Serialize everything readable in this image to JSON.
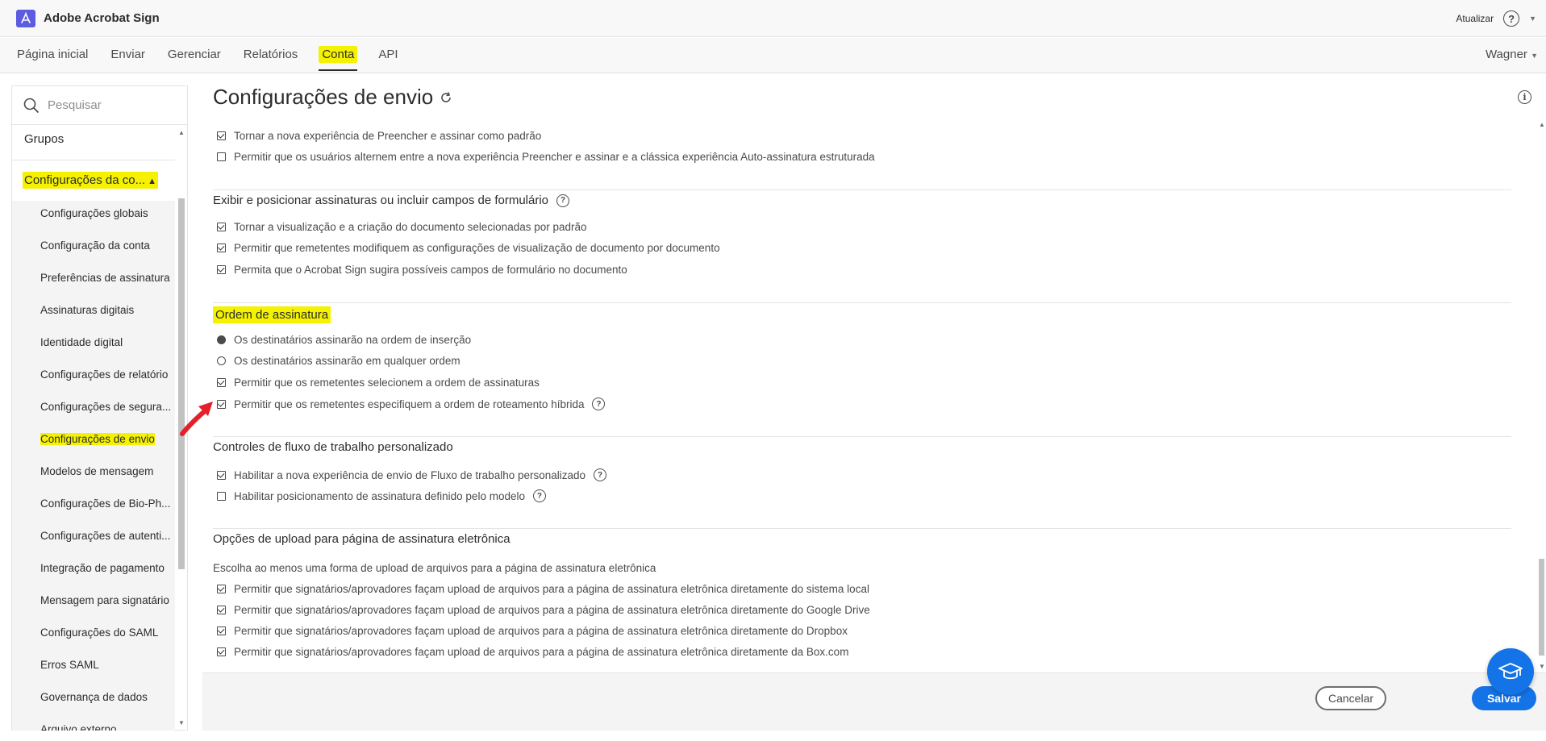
{
  "app": {
    "title": "Adobe Acrobat Sign"
  },
  "topbar": {
    "update_label": "Atualizar",
    "help_symbol": "?"
  },
  "nav": {
    "items": [
      {
        "label": "Página inicial"
      },
      {
        "label": "Enviar"
      },
      {
        "label": "Gerenciar"
      },
      {
        "label": "Relatórios"
      },
      {
        "label": "Conta"
      },
      {
        "label": "API"
      }
    ],
    "active": "Conta",
    "user": "Wagner"
  },
  "sidebar": {
    "search_placeholder": "Pesquisar",
    "group": "Grupos",
    "parent": "Configurações da co...",
    "children": [
      {
        "label": "Configurações globais"
      },
      {
        "label": "Configuração da conta"
      },
      {
        "label": "Preferências de assinatura"
      },
      {
        "label": "Assinaturas digitais"
      },
      {
        "label": "Identidade digital"
      },
      {
        "label": "Configurações de relatório"
      },
      {
        "label": "Configurações de segura..."
      },
      {
        "label": "Configurações de envio"
      },
      {
        "label": "Modelos de mensagem"
      },
      {
        "label": "Configurações de Bio-Ph..."
      },
      {
        "label": "Configurações de autenti..."
      },
      {
        "label": "Integração de pagamento"
      },
      {
        "label": "Mensagem para signatário"
      },
      {
        "label": "Configurações do SAML"
      },
      {
        "label": "Erros SAML"
      },
      {
        "label": "Governança de dados"
      },
      {
        "label": "Arquivo externo"
      }
    ],
    "active_child": "Configurações de envio"
  },
  "main": {
    "title": "Configurações de envio",
    "top_options": [
      {
        "label": "Tornar a nova experiência de Preencher e assinar como padrão",
        "checked": true
      },
      {
        "label": "Permitir que os usuários alternem entre a nova experiência Preencher e assinar e a clássica experiência Auto-assinatura estruturada",
        "checked": false
      }
    ],
    "section_display": {
      "title": "Exibir e posicionar assinaturas ou incluir campos de formulário",
      "options": [
        {
          "label": "Tornar a visualização e a criação do documento selecionadas por padrão",
          "checked": true
        },
        {
          "label": "Permitir que remetentes modifiquem as configurações de visualização de documento por documento",
          "checked": true
        },
        {
          "label": "Permita que o Acrobat Sign sugira possíveis campos de formulário no documento",
          "checked": true
        }
      ]
    },
    "section_order": {
      "title": "Ordem de assinatura",
      "radios": [
        {
          "label": "Os destinatários assinarão na ordem de inserção",
          "selected": true
        },
        {
          "label": "Os destinatários assinarão em qualquer ordem",
          "selected": false
        }
      ],
      "options": [
        {
          "label": "Permitir que os remetentes selecionem a ordem de assinaturas",
          "checked": true
        },
        {
          "label": "Permitir que os remetentes especifiquem a ordem de roteamento híbrida",
          "checked": true
        }
      ]
    },
    "section_workflow": {
      "title": "Controles de fluxo de trabalho personalizado",
      "options": [
        {
          "label": "Habilitar a nova experiência de envio de Fluxo de trabalho personalizado",
          "checked": true
        },
        {
          "label": "Habilitar posicionamento de assinatura definido pelo modelo",
          "checked": false
        }
      ]
    },
    "section_upload": {
      "title": "Opções de upload para página de assinatura eletrônica",
      "description": "Escolha ao menos uma forma de upload de arquivos para a página de assinatura eletrônica",
      "options": [
        {
          "label": "Permitir que signatários/aprovadores façam upload de arquivos para a página de assinatura eletrônica diretamente do sistema local",
          "checked": true
        },
        {
          "label": "Permitir que signatários/aprovadores façam upload de arquivos para a página de assinatura eletrônica diretamente do Google Drive",
          "checked": true
        },
        {
          "label": "Permitir que signatários/aprovadores façam upload de arquivos para a página de assinatura eletrônica diretamente do Dropbox",
          "checked": true
        },
        {
          "label": "Permitir que signatários/aprovadores façam upload de arquivos para a página de assinatura eletrônica diretamente da Box.com",
          "checked": true
        }
      ]
    }
  },
  "footer": {
    "cancel_label": "Cancelar",
    "save_label": "Salvar"
  },
  "colors": {
    "accent": "#1473e6",
    "highlight": "#f5f200",
    "annotation_arrow": "#e4202a",
    "logo": "#5c5ce0"
  }
}
